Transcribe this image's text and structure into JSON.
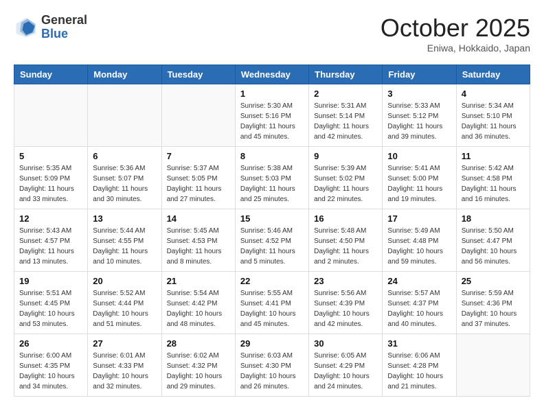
{
  "header": {
    "logo_general": "General",
    "logo_blue": "Blue",
    "title": "October 2025",
    "subtitle": "Eniwa, Hokkaido, Japan"
  },
  "days_of_week": [
    "Sunday",
    "Monday",
    "Tuesday",
    "Wednesday",
    "Thursday",
    "Friday",
    "Saturday"
  ],
  "weeks": [
    [
      {
        "day": "",
        "info": ""
      },
      {
        "day": "",
        "info": ""
      },
      {
        "day": "",
        "info": ""
      },
      {
        "day": "1",
        "info": "Sunrise: 5:30 AM\nSunset: 5:16 PM\nDaylight: 11 hours\nand 45 minutes."
      },
      {
        "day": "2",
        "info": "Sunrise: 5:31 AM\nSunset: 5:14 PM\nDaylight: 11 hours\nand 42 minutes."
      },
      {
        "day": "3",
        "info": "Sunrise: 5:33 AM\nSunset: 5:12 PM\nDaylight: 11 hours\nand 39 minutes."
      },
      {
        "day": "4",
        "info": "Sunrise: 5:34 AM\nSunset: 5:10 PM\nDaylight: 11 hours\nand 36 minutes."
      }
    ],
    [
      {
        "day": "5",
        "info": "Sunrise: 5:35 AM\nSunset: 5:09 PM\nDaylight: 11 hours\nand 33 minutes."
      },
      {
        "day": "6",
        "info": "Sunrise: 5:36 AM\nSunset: 5:07 PM\nDaylight: 11 hours\nand 30 minutes."
      },
      {
        "day": "7",
        "info": "Sunrise: 5:37 AM\nSunset: 5:05 PM\nDaylight: 11 hours\nand 27 minutes."
      },
      {
        "day": "8",
        "info": "Sunrise: 5:38 AM\nSunset: 5:03 PM\nDaylight: 11 hours\nand 25 minutes."
      },
      {
        "day": "9",
        "info": "Sunrise: 5:39 AM\nSunset: 5:02 PM\nDaylight: 11 hours\nand 22 minutes."
      },
      {
        "day": "10",
        "info": "Sunrise: 5:41 AM\nSunset: 5:00 PM\nDaylight: 11 hours\nand 19 minutes."
      },
      {
        "day": "11",
        "info": "Sunrise: 5:42 AM\nSunset: 4:58 PM\nDaylight: 11 hours\nand 16 minutes."
      }
    ],
    [
      {
        "day": "12",
        "info": "Sunrise: 5:43 AM\nSunset: 4:57 PM\nDaylight: 11 hours\nand 13 minutes."
      },
      {
        "day": "13",
        "info": "Sunrise: 5:44 AM\nSunset: 4:55 PM\nDaylight: 11 hours\nand 10 minutes."
      },
      {
        "day": "14",
        "info": "Sunrise: 5:45 AM\nSunset: 4:53 PM\nDaylight: 11 hours\nand 8 minutes."
      },
      {
        "day": "15",
        "info": "Sunrise: 5:46 AM\nSunset: 4:52 PM\nDaylight: 11 hours\nand 5 minutes."
      },
      {
        "day": "16",
        "info": "Sunrise: 5:48 AM\nSunset: 4:50 PM\nDaylight: 11 hours\nand 2 minutes."
      },
      {
        "day": "17",
        "info": "Sunrise: 5:49 AM\nSunset: 4:48 PM\nDaylight: 10 hours\nand 59 minutes."
      },
      {
        "day": "18",
        "info": "Sunrise: 5:50 AM\nSunset: 4:47 PM\nDaylight: 10 hours\nand 56 minutes."
      }
    ],
    [
      {
        "day": "19",
        "info": "Sunrise: 5:51 AM\nSunset: 4:45 PM\nDaylight: 10 hours\nand 53 minutes."
      },
      {
        "day": "20",
        "info": "Sunrise: 5:52 AM\nSunset: 4:44 PM\nDaylight: 10 hours\nand 51 minutes."
      },
      {
        "day": "21",
        "info": "Sunrise: 5:54 AM\nSunset: 4:42 PM\nDaylight: 10 hours\nand 48 minutes."
      },
      {
        "day": "22",
        "info": "Sunrise: 5:55 AM\nSunset: 4:41 PM\nDaylight: 10 hours\nand 45 minutes."
      },
      {
        "day": "23",
        "info": "Sunrise: 5:56 AM\nSunset: 4:39 PM\nDaylight: 10 hours\nand 42 minutes."
      },
      {
        "day": "24",
        "info": "Sunrise: 5:57 AM\nSunset: 4:37 PM\nDaylight: 10 hours\nand 40 minutes."
      },
      {
        "day": "25",
        "info": "Sunrise: 5:59 AM\nSunset: 4:36 PM\nDaylight: 10 hours\nand 37 minutes."
      }
    ],
    [
      {
        "day": "26",
        "info": "Sunrise: 6:00 AM\nSunset: 4:35 PM\nDaylight: 10 hours\nand 34 minutes."
      },
      {
        "day": "27",
        "info": "Sunrise: 6:01 AM\nSunset: 4:33 PM\nDaylight: 10 hours\nand 32 minutes."
      },
      {
        "day": "28",
        "info": "Sunrise: 6:02 AM\nSunset: 4:32 PM\nDaylight: 10 hours\nand 29 minutes."
      },
      {
        "day": "29",
        "info": "Sunrise: 6:03 AM\nSunset: 4:30 PM\nDaylight: 10 hours\nand 26 minutes."
      },
      {
        "day": "30",
        "info": "Sunrise: 6:05 AM\nSunset: 4:29 PM\nDaylight: 10 hours\nand 24 minutes."
      },
      {
        "day": "31",
        "info": "Sunrise: 6:06 AM\nSunset: 4:28 PM\nDaylight: 10 hours\nand 21 minutes."
      },
      {
        "day": "",
        "info": ""
      }
    ]
  ]
}
